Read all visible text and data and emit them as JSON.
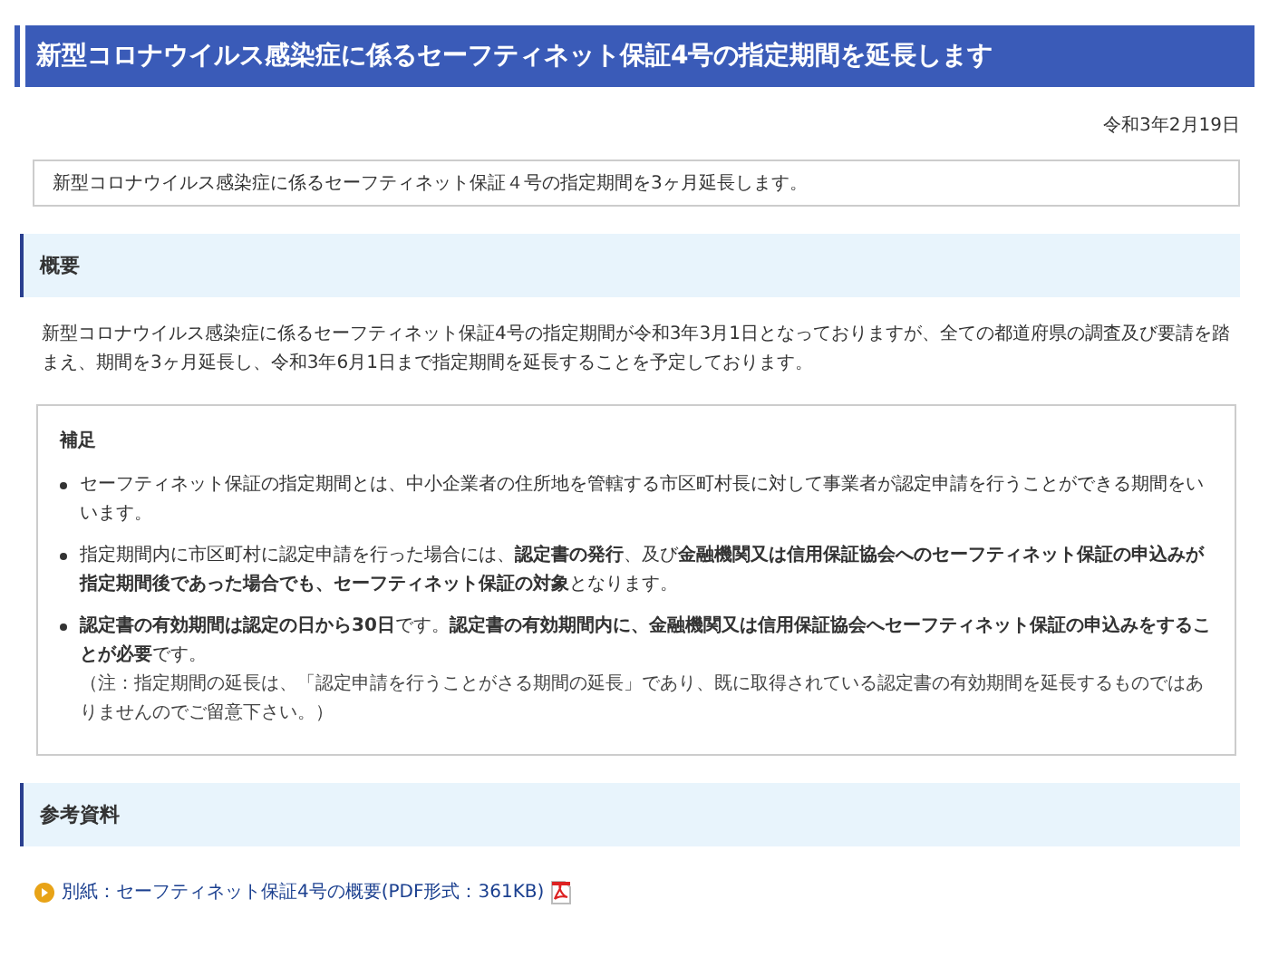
{
  "title": "新型コロナウイルス感染症に係るセーフティネット保証4号の指定期間を延長します",
  "date": "令和3年2月19日",
  "summary": "新型コロナウイルス感染症に係るセーフティネット保証４号の指定期間を3ヶ月延長します。",
  "sections": [
    {
      "heading": "概要",
      "paragraph": "新型コロナウイルス感染症に係るセーフティネット保証4号の指定期間が令和3年3月1日となっておりますが、全ての都道府県の調査及び要請を踏まえ、期間を3ヶ月延長し、令和3年6月1日まで指定期間を延長することを予定しております。",
      "note_box": {
        "heading": "補足",
        "items": [
          {
            "text": "セーフティネット保証の指定期間とは、中小企業者の住所地を管轄する市区町村長に対して事業者が認定申請を行うことができる期間をいいます。"
          },
          {
            "text": "指定期間内に市区町村に認定申請を行った場合には、**認定書の発行**、及び**金融機関又は信用保証協会へのセーフティネット保証の申込みが指定期間後であった場合でも、セーフティネット保証の対象**となります。"
          },
          {
            "text": "**認定書の有効期間は認定の日から30日**です。**認定書の有効期間内に、金融機関又は信用保証協会へセーフティネット保証の申込みをすることが必要**です。",
            "note": "（注：指定期間の延長は、「認定申請を行うことがさる期間の延長」であり、既に取得されている認定書の有効期間を延長するものではありませんのでご留意下さい。）"
          }
        ]
      }
    },
    {
      "heading": "参考資料",
      "links": [
        {
          "text": "別紙：セーフティネット保証4号の概要(PDF形式：361KB)"
        }
      ]
    }
  ]
}
